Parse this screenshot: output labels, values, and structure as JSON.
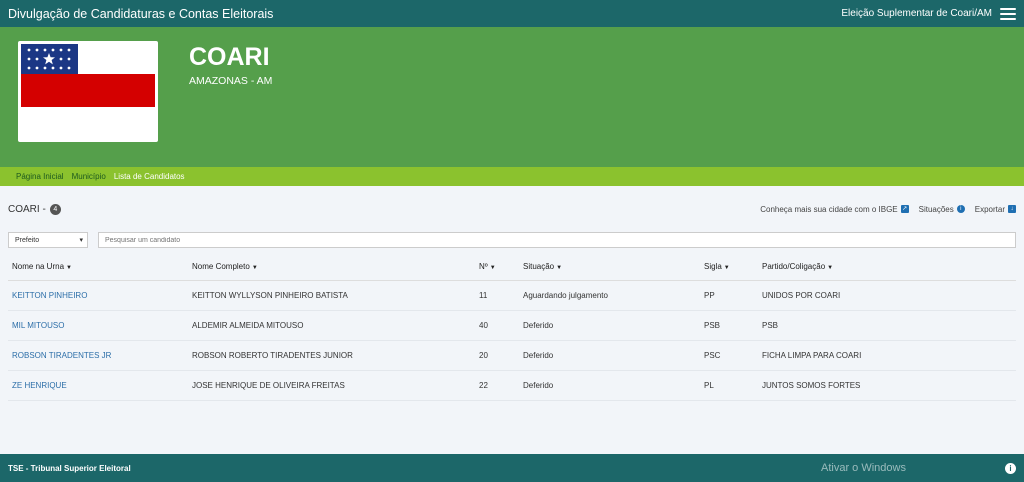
{
  "header": {
    "app_title": "Divulgação de Candidaturas e Contas Eleitorais",
    "election": "Eleição Suplementar de Coari/AM"
  },
  "banner": {
    "city": "COARI",
    "state": "AMAZONAS - AM"
  },
  "breadcrumb": {
    "items": [
      "Página Inicial",
      "Município",
      "Lista de Candidatos"
    ]
  },
  "summary": {
    "city_label": "COARI -",
    "count": "4",
    "ibge_link": "Conheça mais sua cidade com o IBGE",
    "situations_link": "Situações",
    "export_link": "Exportar"
  },
  "filters": {
    "office_selected": "Prefeito",
    "search_placeholder": "Pesquisar um candidato"
  },
  "table": {
    "columns": [
      "Nome na Urna",
      "Nome Completo",
      "Nº",
      "Situação",
      "Sigla",
      "Partido/Coligação"
    ],
    "rows": [
      [
        "KEITTON PINHEIRO",
        "KEITTON WYLLYSON PINHEIRO BATISTA",
        "11",
        "Aguardando julgamento",
        "PP",
        "UNIDOS POR COARI"
      ],
      [
        "MIL MITOUSO",
        "ALDEMIR ALMEIDA MITOUSO",
        "40",
        "Deferido",
        "PSB",
        "PSB"
      ],
      [
        "ROBSON TIRADENTES JR",
        "ROBSON ROBERTO TIRADENTES JUNIOR",
        "20",
        "Deferido",
        "PSC",
        "FICHA LIMPA PARA COARI"
      ],
      [
        "ZE HENRIQUE",
        "JOSE HENRIQUE DE OLIVEIRA FREITAS",
        "22",
        "Deferido",
        "PL",
        "JUNTOS SOMOS FORTES"
      ]
    ]
  },
  "footer": {
    "text": "TSE - Tribunal Superior Eleitoral",
    "watermark": "Ativar o Windows"
  },
  "colors": {
    "topbar": "#1c6769",
    "banner": "#559f4b",
    "breadcrumb": "#8bc22e",
    "link": "#2c6ea8"
  }
}
